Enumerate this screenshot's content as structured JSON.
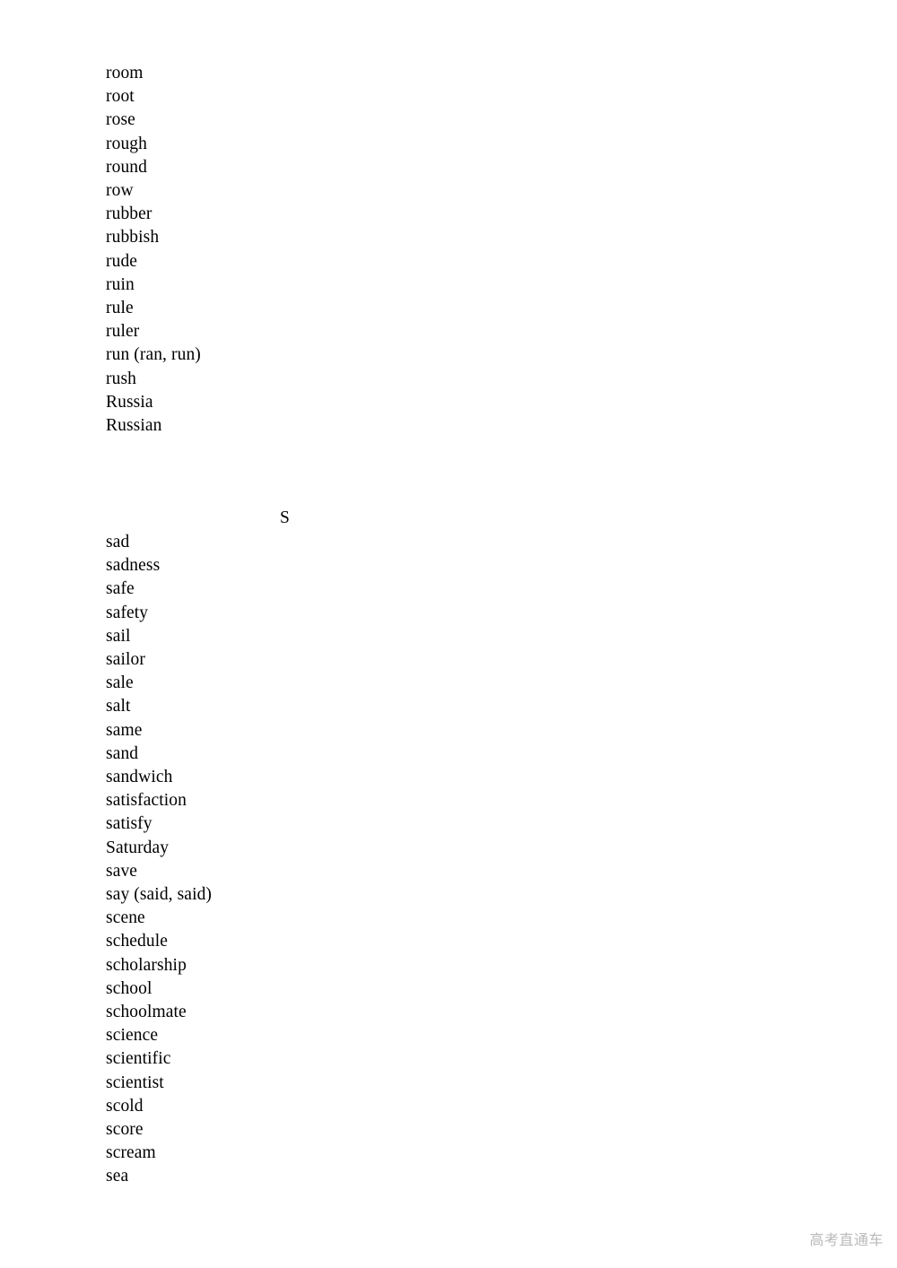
{
  "document": {
    "type": "vocabulary-word-list",
    "page_background": "#ffffff",
    "text_color": "#000000"
  },
  "sections": [
    {
      "id": "r-section",
      "heading": "",
      "words": [
        "room",
        "root",
        "rose",
        "rough",
        "round",
        "row",
        "rubber",
        "rubbish",
        "rude",
        "ruin",
        "rule",
        "ruler",
        "run (ran, run)",
        "rush",
        "Russia",
        "Russian"
      ]
    },
    {
      "id": "s-section",
      "heading": "S",
      "words": [
        "sad",
        "sadness",
        "safe",
        "safety",
        "sail",
        "sailor",
        "sale",
        "salt",
        "same",
        "sand",
        "sandwich",
        "satisfaction",
        "satisfy",
        "Saturday",
        "save",
        "say (said, said)",
        "scene",
        "schedule",
        "scholarship",
        "school",
        "schoolmate",
        "science",
        "scientific",
        "scientist",
        "scold",
        "score",
        "scream",
        "sea"
      ]
    }
  ],
  "watermark": {
    "text": "高考直通车",
    "color": "#b9b9b9"
  }
}
